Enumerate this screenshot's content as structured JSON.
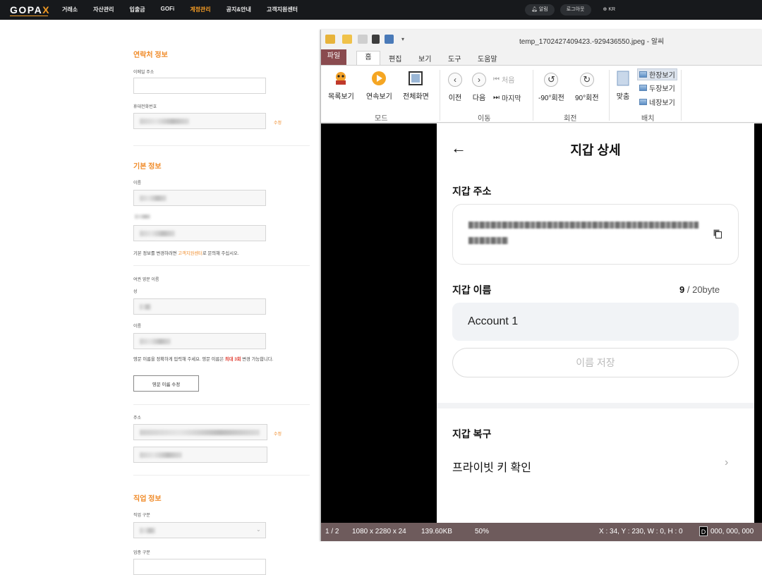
{
  "topnav": {
    "logo": "GOPA",
    "logo_x": "X",
    "items": [
      "거래소",
      "자산관리",
      "입출금",
      "GOFi",
      "계정관리",
      "공지&안내",
      "고객지원센터"
    ],
    "active_index": 4,
    "right": [
      "알림",
      "로그아웃",
      "KR"
    ],
    "accent": "#f39b24"
  },
  "page": {
    "contact_title": "연락처 정보",
    "email_label": "이메일 주소",
    "phone_label": "휴대전화번호",
    "modify": "수정",
    "basic_title": "기본 정보",
    "name_label": "이름",
    "basic_note_prefix": "기본 정보를 변경하려면 ",
    "basic_note_link": "고객지원센터",
    "basic_note_suffix": "로 문의해 주십시오.",
    "eng_name_label": "여권 영문 이름",
    "surname_label": "성",
    "given_label": "이름",
    "eng_note_prefix": "영문 이름을 정확하게 입력해 주세요. 영문 이름은 ",
    "eng_note_red": "최대 3회",
    "eng_note_suffix": " 변경 가능합니다.",
    "eng_modify_btn": "영문 이름 수정",
    "address_label": "주소",
    "job_title": "직업 정보",
    "job_type_label": "직업 구분",
    "industry_label": "업종 구분"
  },
  "viewer": {
    "title": "temp_1702427409423.-929436550.jpeg - 알씨",
    "menus": [
      "파일",
      "홈",
      "편집",
      "보기",
      "도구",
      "도움말"
    ],
    "ribbon": {
      "mode": [
        "목록보기",
        "연속보기",
        "전체화면"
      ],
      "mode_label": "모드",
      "nav": [
        "이전",
        "다음"
      ],
      "first": "처음",
      "last": "마지막",
      "nav_label": "이동",
      "rotate": [
        "-90°회전",
        "90°회전"
      ],
      "rotate_label": "회전",
      "fit": "맞춤",
      "layouts": [
        "한장보기",
        "두장보기",
        "네장보기"
      ],
      "layout_label": "배치"
    },
    "image": {
      "header": "지갑 상세",
      "address_title": "지갑 주소",
      "name_title": "지갑 이름",
      "name_count": "9",
      "name_max": "/ 20byte",
      "name_value": "Account 1",
      "save_label": "이름 저장",
      "recovery_title": "지갑 복구",
      "private_key_label": "프라이빗 키 확인"
    },
    "status": {
      "page": "1 / 2",
      "dims": "1080 x 2280 x 24",
      "size": "139.60KB",
      "zoom": "50%",
      "coords": "X : 34, Y : 230, W : 0, H : 0",
      "d": "D",
      "rgb": "000, 000, 000"
    }
  }
}
